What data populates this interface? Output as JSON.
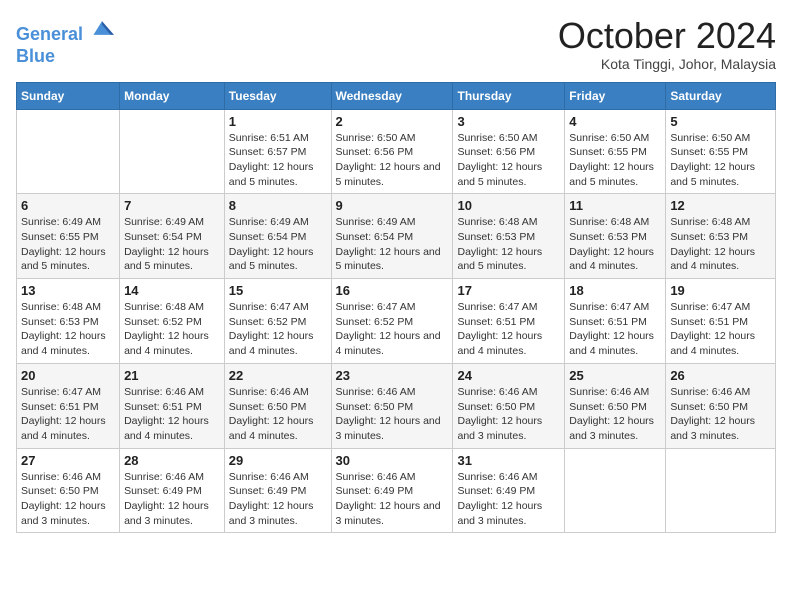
{
  "logo": {
    "line1": "General",
    "line2": "Blue"
  },
  "title": "October 2024",
  "location": "Kota Tinggi, Johor, Malaysia",
  "days_of_week": [
    "Sunday",
    "Monday",
    "Tuesday",
    "Wednesday",
    "Thursday",
    "Friday",
    "Saturday"
  ],
  "weeks": [
    [
      {
        "day": "",
        "info": ""
      },
      {
        "day": "",
        "info": ""
      },
      {
        "day": "1",
        "info": "Sunrise: 6:51 AM\nSunset: 6:57 PM\nDaylight: 12 hours and 5 minutes."
      },
      {
        "day": "2",
        "info": "Sunrise: 6:50 AM\nSunset: 6:56 PM\nDaylight: 12 hours and 5 minutes."
      },
      {
        "day": "3",
        "info": "Sunrise: 6:50 AM\nSunset: 6:56 PM\nDaylight: 12 hours and 5 minutes."
      },
      {
        "day": "4",
        "info": "Sunrise: 6:50 AM\nSunset: 6:55 PM\nDaylight: 12 hours and 5 minutes."
      },
      {
        "day": "5",
        "info": "Sunrise: 6:50 AM\nSunset: 6:55 PM\nDaylight: 12 hours and 5 minutes."
      }
    ],
    [
      {
        "day": "6",
        "info": "Sunrise: 6:49 AM\nSunset: 6:55 PM\nDaylight: 12 hours and 5 minutes."
      },
      {
        "day": "7",
        "info": "Sunrise: 6:49 AM\nSunset: 6:54 PM\nDaylight: 12 hours and 5 minutes."
      },
      {
        "day": "8",
        "info": "Sunrise: 6:49 AM\nSunset: 6:54 PM\nDaylight: 12 hours and 5 minutes."
      },
      {
        "day": "9",
        "info": "Sunrise: 6:49 AM\nSunset: 6:54 PM\nDaylight: 12 hours and 5 minutes."
      },
      {
        "day": "10",
        "info": "Sunrise: 6:48 AM\nSunset: 6:53 PM\nDaylight: 12 hours and 5 minutes."
      },
      {
        "day": "11",
        "info": "Sunrise: 6:48 AM\nSunset: 6:53 PM\nDaylight: 12 hours and 4 minutes."
      },
      {
        "day": "12",
        "info": "Sunrise: 6:48 AM\nSunset: 6:53 PM\nDaylight: 12 hours and 4 minutes."
      }
    ],
    [
      {
        "day": "13",
        "info": "Sunrise: 6:48 AM\nSunset: 6:53 PM\nDaylight: 12 hours and 4 minutes."
      },
      {
        "day": "14",
        "info": "Sunrise: 6:48 AM\nSunset: 6:52 PM\nDaylight: 12 hours and 4 minutes."
      },
      {
        "day": "15",
        "info": "Sunrise: 6:47 AM\nSunset: 6:52 PM\nDaylight: 12 hours and 4 minutes."
      },
      {
        "day": "16",
        "info": "Sunrise: 6:47 AM\nSunset: 6:52 PM\nDaylight: 12 hours and 4 minutes."
      },
      {
        "day": "17",
        "info": "Sunrise: 6:47 AM\nSunset: 6:51 PM\nDaylight: 12 hours and 4 minutes."
      },
      {
        "day": "18",
        "info": "Sunrise: 6:47 AM\nSunset: 6:51 PM\nDaylight: 12 hours and 4 minutes."
      },
      {
        "day": "19",
        "info": "Sunrise: 6:47 AM\nSunset: 6:51 PM\nDaylight: 12 hours and 4 minutes."
      }
    ],
    [
      {
        "day": "20",
        "info": "Sunrise: 6:47 AM\nSunset: 6:51 PM\nDaylight: 12 hours and 4 minutes."
      },
      {
        "day": "21",
        "info": "Sunrise: 6:46 AM\nSunset: 6:51 PM\nDaylight: 12 hours and 4 minutes."
      },
      {
        "day": "22",
        "info": "Sunrise: 6:46 AM\nSunset: 6:50 PM\nDaylight: 12 hours and 4 minutes."
      },
      {
        "day": "23",
        "info": "Sunrise: 6:46 AM\nSunset: 6:50 PM\nDaylight: 12 hours and 3 minutes."
      },
      {
        "day": "24",
        "info": "Sunrise: 6:46 AM\nSunset: 6:50 PM\nDaylight: 12 hours and 3 minutes."
      },
      {
        "day": "25",
        "info": "Sunrise: 6:46 AM\nSunset: 6:50 PM\nDaylight: 12 hours and 3 minutes."
      },
      {
        "day": "26",
        "info": "Sunrise: 6:46 AM\nSunset: 6:50 PM\nDaylight: 12 hours and 3 minutes."
      }
    ],
    [
      {
        "day": "27",
        "info": "Sunrise: 6:46 AM\nSunset: 6:50 PM\nDaylight: 12 hours and 3 minutes."
      },
      {
        "day": "28",
        "info": "Sunrise: 6:46 AM\nSunset: 6:49 PM\nDaylight: 12 hours and 3 minutes."
      },
      {
        "day": "29",
        "info": "Sunrise: 6:46 AM\nSunset: 6:49 PM\nDaylight: 12 hours and 3 minutes."
      },
      {
        "day": "30",
        "info": "Sunrise: 6:46 AM\nSunset: 6:49 PM\nDaylight: 12 hours and 3 minutes."
      },
      {
        "day": "31",
        "info": "Sunrise: 6:46 AM\nSunset: 6:49 PM\nDaylight: 12 hours and 3 minutes."
      },
      {
        "day": "",
        "info": ""
      },
      {
        "day": "",
        "info": ""
      }
    ]
  ]
}
